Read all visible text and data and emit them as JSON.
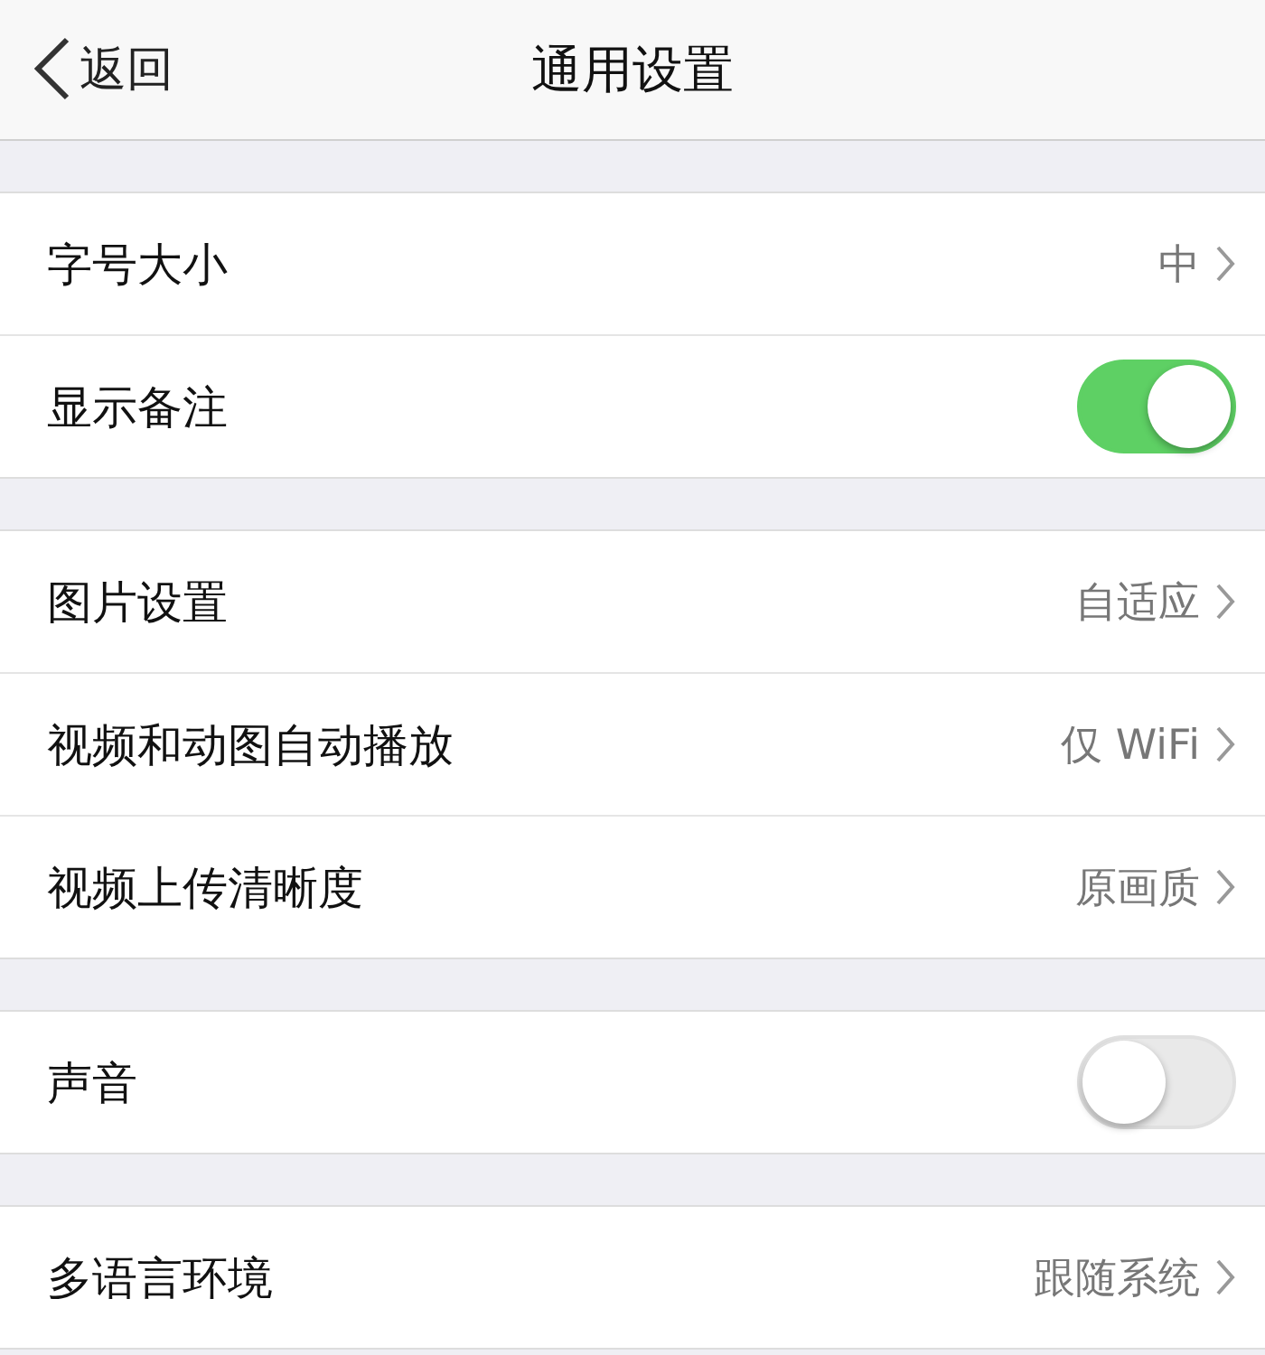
{
  "nav": {
    "back": "返回",
    "title": "通用设置"
  },
  "sections": [
    {
      "rows": [
        {
          "kind": "link",
          "label": "字号大小",
          "value": "中"
        },
        {
          "kind": "toggle",
          "label": "显示备注",
          "on": true
        }
      ]
    },
    {
      "rows": [
        {
          "kind": "link",
          "label": "图片设置",
          "value": "自适应"
        },
        {
          "kind": "link",
          "label": "视频和动图自动播放",
          "value": "仅 WiFi"
        },
        {
          "kind": "link",
          "label": "视频上传清晰度",
          "value": "原画质"
        }
      ]
    },
    {
      "rows": [
        {
          "kind": "toggle",
          "label": "声音",
          "on": false
        }
      ]
    },
    {
      "rows": [
        {
          "kind": "link",
          "label": "多语言环境",
          "value": "跟随系统"
        }
      ]
    }
  ]
}
